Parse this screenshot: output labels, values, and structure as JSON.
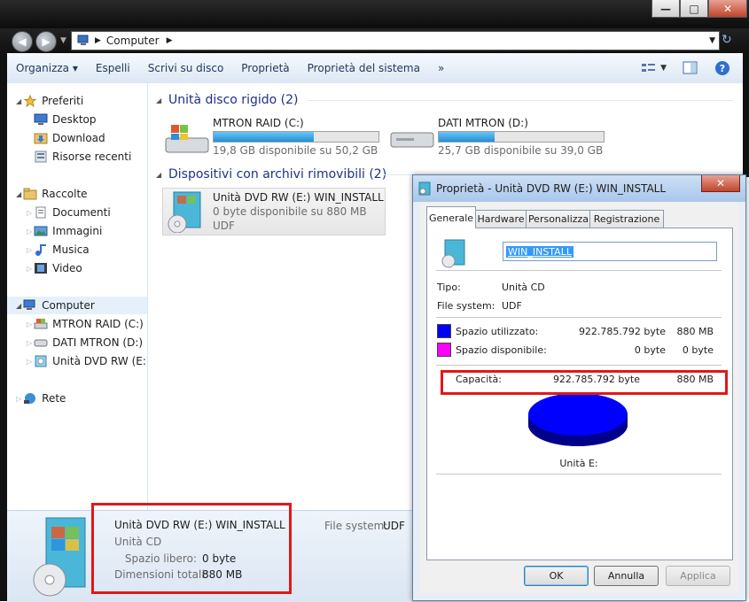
{
  "window": {
    "caption_buttons": {
      "minimize": "—",
      "maximize": "□",
      "close": "✕"
    },
    "address": {
      "icon": "computer-icon",
      "path": "Computer"
    },
    "toolbar": {
      "items": [
        "Organizza",
        "Espelli",
        "Scrivi su disco",
        "Proprietà",
        "Proprietà del sistema",
        "»"
      ],
      "organizza_arrow": "▾"
    }
  },
  "navpane": {
    "favorites": {
      "label": "Preferiti",
      "items": [
        "Desktop",
        "Download",
        "Risorse recenti"
      ]
    },
    "libraries": {
      "label": "Raccolte",
      "items": [
        "Documenti",
        "Immagini",
        "Musica",
        "Video"
      ]
    },
    "computer": {
      "label": "Computer",
      "items": [
        "MTRON RAID (C:)",
        "DATI MTRON (D:)",
        "Unità DVD RW (E:) W"
      ]
    },
    "network": {
      "label": "Rete"
    }
  },
  "content": {
    "hdd_group": "Unità disco rigido (2)",
    "drives": [
      {
        "name": "MTRON RAID (C:)",
        "free": "19,8 GB disponibile su 50,2 GB",
        "used_fraction": 0.61
      },
      {
        "name": "DATI MTRON (D:)",
        "free": "25,7 GB disponibile su 39,0 GB",
        "used_fraction": 0.34
      }
    ],
    "removable_group": "Dispositivi con archivi rimovibili (2)",
    "dvd": {
      "name": "Unità DVD RW (E:) WIN_INSTALL",
      "free": "0 byte disponibile su 880 MB",
      "fs": "UDF"
    }
  },
  "details": {
    "title": "Unità DVD RW (E:) WIN_INSTALL",
    "type": "Unità CD",
    "free_label": "Spazio libero:",
    "free_value": "0 byte",
    "total_label": "Dimensioni totali:",
    "total_value": "880 MB",
    "fs_label": "File system:",
    "fs_value": "UDF"
  },
  "dialog": {
    "title": "Proprietà - Unità DVD RW (E:) WIN_INSTALL",
    "close": "✕",
    "tabs": [
      "Generale",
      "Hardware",
      "Personalizza",
      "Registrazione"
    ],
    "volume_label": "WIN_INSTALL",
    "type_label": "Tipo:",
    "type_value": "Unità CD",
    "fs_label": "File system:",
    "fs_value": "UDF",
    "used_label": "Spazio utilizzato:",
    "used_bytes": "922.785.792 byte",
    "used_size": "880 MB",
    "free_label": "Spazio disponibile:",
    "free_bytes": "0 byte",
    "free_size": "0 byte",
    "capacity_label": "Capacità:",
    "capacity_bytes": "922.785.792 byte",
    "capacity_size": "880 MB",
    "drive_caption": "Unità E:",
    "buttons": {
      "ok": "OK",
      "cancel": "Annulla",
      "apply": "Applica"
    },
    "colors": {
      "used": "#0000ff",
      "free": "#ff00ff"
    },
    "pie_used_fraction": 1.0
  }
}
